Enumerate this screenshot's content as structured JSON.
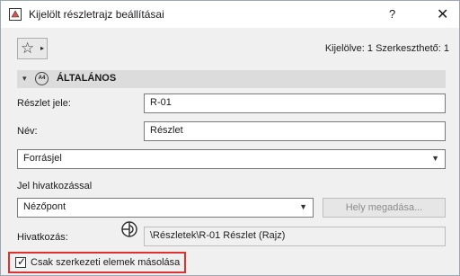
{
  "window": {
    "title": "Kijelölt részletrajz beállításai",
    "help_label": "?",
    "close_label": "✕"
  },
  "toolbar": {
    "favorites_icon": "☆",
    "favorites_caret": "▸",
    "selection_info": "Kijelölve: 1 Szerkeszthető: 1"
  },
  "section": {
    "toggle": "▾",
    "icon_text": "A4",
    "title": "ÁLTALÁNOS"
  },
  "form": {
    "detail_id_label": "Részlet jele:",
    "detail_id_value": "R-01",
    "name_label": "Név:",
    "name_value": "Részlet",
    "source_select": "Forrásjel",
    "marker_ref_label": "Jel hivatkozással",
    "view_select": "Nézőpont",
    "set_location_button": "Hely megadása...",
    "reference_label": "Hivatkozás:",
    "reference_value": "\\Részletek\\R-01 Részlet (Rajz)",
    "copy_structural_label": "Csak szerkezeti elemek másolása",
    "copy_structural_checked": true
  },
  "icons": {
    "app": "drawing-marker-icon",
    "link": "reference-link-icon",
    "checkmark": "✓"
  }
}
